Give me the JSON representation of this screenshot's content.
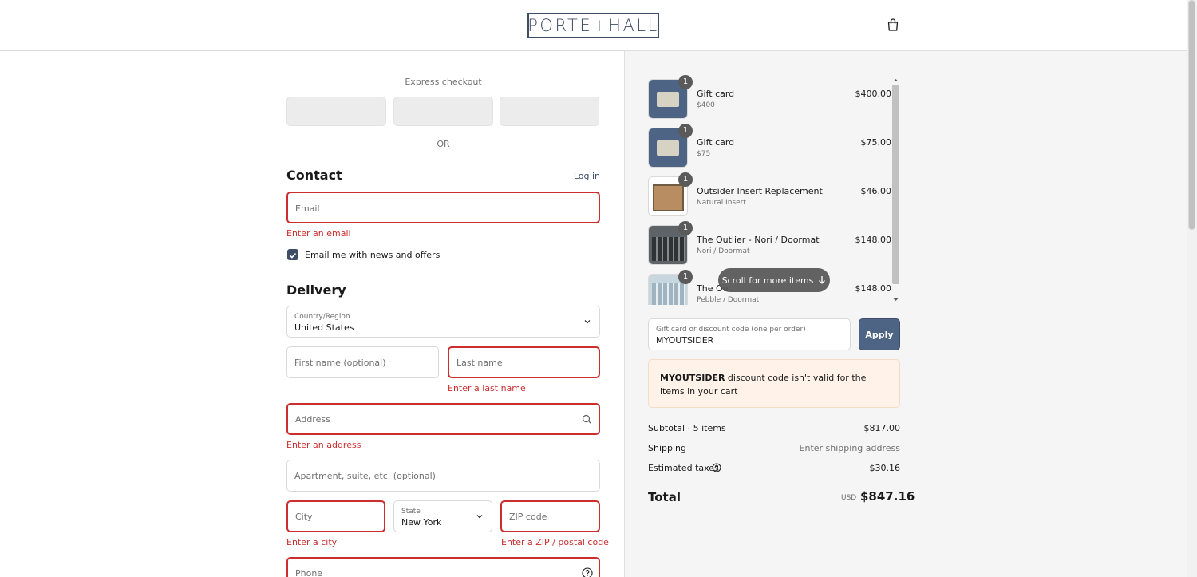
{
  "header": {
    "logo_text": "PORTE+HALL",
    "cart_icon": "shopping-bag-icon"
  },
  "express": {
    "title": "Express checkout",
    "or_label": "OR"
  },
  "contact": {
    "heading": "Contact",
    "login_label": "Log in",
    "email_placeholder": "Email",
    "email_error": "Enter an email",
    "newsletter_label": "Email me with news and offers",
    "newsletter_checked": true
  },
  "delivery": {
    "heading": "Delivery",
    "country_label": "Country/Region",
    "country_value": "United States",
    "first_name_placeholder": "First name (optional)",
    "last_name_placeholder": "Last name",
    "last_name_error": "Enter a last name",
    "address_placeholder": "Address",
    "address_error": "Enter an address",
    "apartment_placeholder": "Apartment, suite, etc. (optional)",
    "city_placeholder": "City",
    "city_error": "Enter a city",
    "state_label": "State",
    "state_value": "New York",
    "zip_placeholder": "ZIP code",
    "zip_error": "Enter a ZIP / postal code",
    "phone_placeholder": "Phone"
  },
  "order": {
    "items": [
      {
        "qty": "1",
        "name": "Gift card",
        "variant": "$400",
        "price": "$400.00"
      },
      {
        "qty": "1",
        "name": "Gift card",
        "variant": "$75",
        "price": "$75.00"
      },
      {
        "qty": "1",
        "name": "Outsider Insert Replacement",
        "variant": "Natural Insert",
        "price": "$46.00"
      },
      {
        "qty": "1",
        "name": "The Outlier - Nori / Doormat",
        "variant": "Nori / Doormat",
        "price": "$148.00"
      },
      {
        "qty": "1",
        "name": "The Ou",
        "variant": "Pebble / Doormat",
        "price": "$148.00"
      }
    ],
    "scroll_hint": "Scroll for more items",
    "discount_label": "Gift card or discount code (one per order)",
    "discount_value": "MYOUTSIDER",
    "apply_label": "Apply",
    "notice_code": "MYOUTSIDER",
    "notice_text": " discount code isn't valid for the items in your cart",
    "subtotal_label": "Subtotal · 5 items",
    "subtotal_value": "$817.00",
    "shipping_label": "Shipping",
    "shipping_value": "Enter shipping address",
    "taxes_label": "Estimated taxes",
    "taxes_value": "$30.16",
    "total_label": "Total",
    "total_currency": "USD",
    "total_value": "$847.16"
  },
  "colors": {
    "accent": "#3d4d66",
    "error": "#cc2d2d",
    "notice_bg": "#fff3e9",
    "summary_bg": "#f5f5f5"
  }
}
